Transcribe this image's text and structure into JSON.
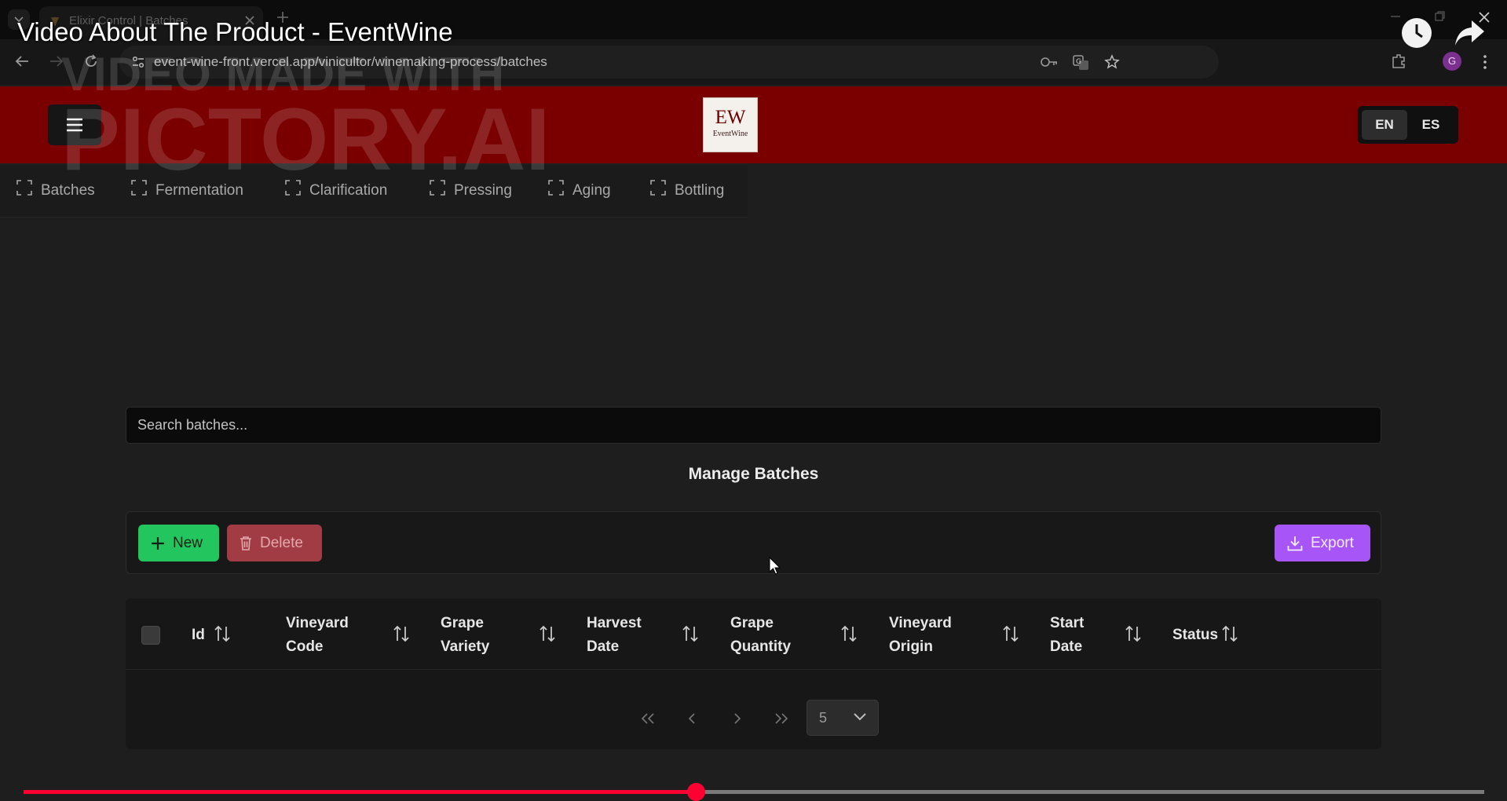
{
  "browser": {
    "tab_title": "Elixir Control | Batches",
    "url": "event-wine-front.vercel.app/vinicultor/winemaking-process/batches",
    "avatar_letter": "G"
  },
  "video": {
    "title": "Video About The Product - EventWine",
    "watermark_line1": "VIDEO MADE WITH",
    "watermark_line2": "PICTORY.AI",
    "progress_fraction": 0.46
  },
  "header": {
    "logo_mark": "EW",
    "logo_text": "EventWine",
    "lang_en": "EN",
    "lang_es": "ES",
    "active_lang": "EN"
  },
  "process_nav": [
    {
      "label": "Batches"
    },
    {
      "label": "Fermentation"
    },
    {
      "label": "Clarification"
    },
    {
      "label": "Pressing"
    },
    {
      "label": "Aging"
    },
    {
      "label": "Bottling"
    }
  ],
  "search": {
    "placeholder": "Search batches..."
  },
  "page_title": "Manage Batches",
  "actions": {
    "new": "New",
    "delete": "Delete",
    "export": "Export"
  },
  "table": {
    "columns": [
      {
        "line1": "Id",
        "line2": ""
      },
      {
        "line1": "Vineyard",
        "line2": "Code"
      },
      {
        "line1": "Grape",
        "line2": "Variety"
      },
      {
        "line1": "Harvest",
        "line2": "Date"
      },
      {
        "line1": "Grape",
        "line2": "Quantity"
      },
      {
        "line1": "Vineyard",
        "line2": "Origin"
      },
      {
        "line1": "Start",
        "line2": "Date"
      },
      {
        "line1": "Status",
        "line2": ""
      }
    ],
    "rows": [],
    "rows_per_page": "5"
  },
  "colors": {
    "header_red": "#7a0000",
    "new_green": "#22c55e",
    "delete_red": "#a13c44",
    "export_purple": "#a855f7",
    "progress_red": "#ff0033"
  }
}
